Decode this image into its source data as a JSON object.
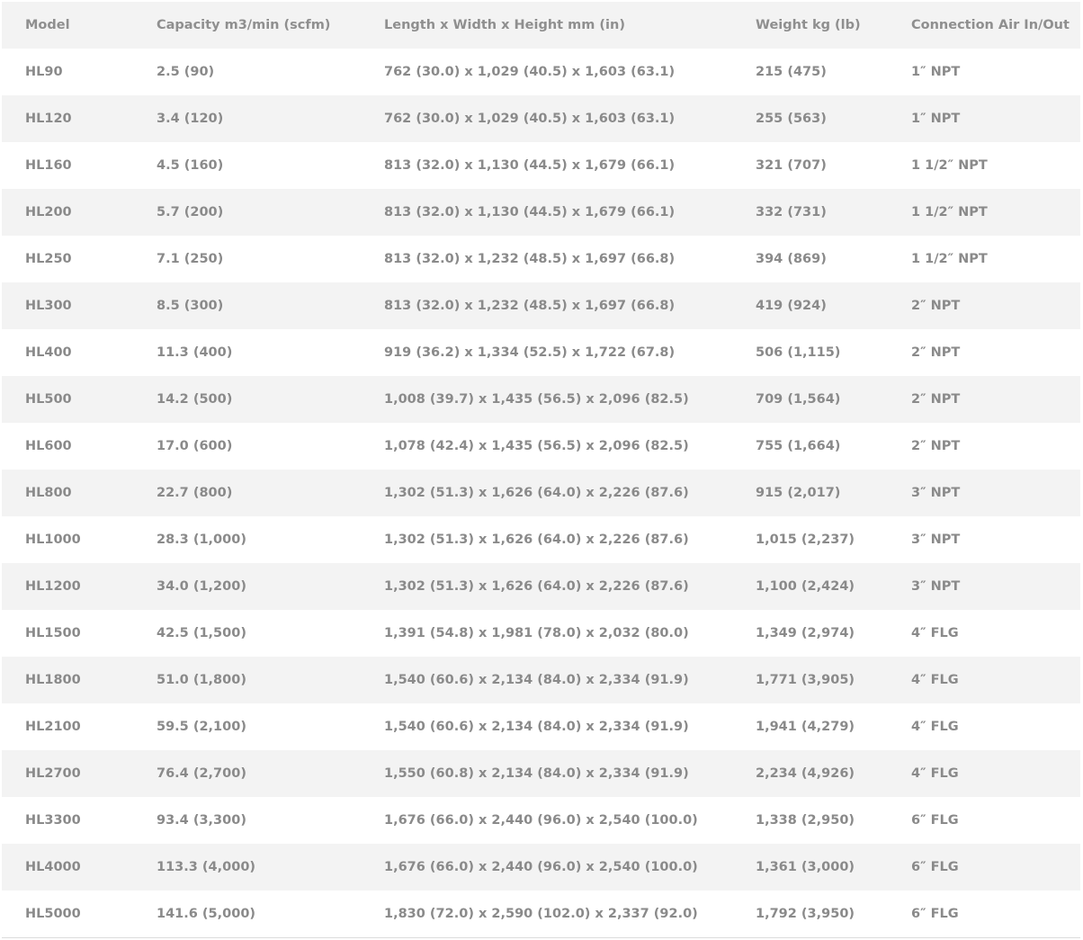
{
  "table": {
    "headers": [
      "Model",
      "Capacity m3/min (scfm)",
      "Length x Width x Height mm (in)",
      "Weight kg (lb)",
      "Connection Air In/Out"
    ],
    "rows": [
      [
        "HL90",
        "2.5 (90)",
        "762 (30.0) x 1,029 (40.5) x 1,603 (63.1)",
        "215 (475)",
        "1″ NPT"
      ],
      [
        "HL120",
        "3.4 (120)",
        "762 (30.0) x 1,029 (40.5) x 1,603 (63.1)",
        "255 (563)",
        "1″ NPT"
      ],
      [
        "HL160",
        "4.5 (160)",
        "813 (32.0) x 1,130 (44.5) x 1,679 (66.1)",
        "321 (707)",
        "1 1/2″ NPT"
      ],
      [
        "HL200",
        "5.7 (200)",
        "813 (32.0) x 1,130 (44.5) x 1,679 (66.1)",
        "332 (731)",
        "1 1/2″ NPT"
      ],
      [
        "HL250",
        "7.1 (250)",
        "813 (32.0) x 1,232 (48.5) x 1,697 (66.8)",
        "394 (869)",
        "1 1/2″ NPT"
      ],
      [
        "HL300",
        "8.5 (300)",
        "813 (32.0) x 1,232 (48.5) x 1,697 (66.8)",
        "419 (924)",
        "2″ NPT"
      ],
      [
        "HL400",
        "11.3 (400)",
        "919 (36.2) x 1,334 (52.5) x 1,722 (67.8)",
        "506 (1,115)",
        "2″ NPT"
      ],
      [
        "HL500",
        "14.2 (500)",
        "1,008 (39.7) x 1,435 (56.5) x 2,096 (82.5)",
        "709 (1,564)",
        "2″ NPT"
      ],
      [
        "HL600",
        "17.0 (600)",
        "1,078 (42.4) x 1,435 (56.5) x 2,096 (82.5)",
        "755 (1,664)",
        "2″ NPT"
      ],
      [
        "HL800",
        "22.7 (800)",
        "1,302 (51.3) x 1,626 (64.0) x 2,226 (87.6)",
        "915 (2,017)",
        "3″ NPT"
      ],
      [
        "HL1000",
        "28.3 (1,000)",
        "1,302 (51.3) x 1,626 (64.0) x 2,226 (87.6)",
        "1,015 (2,237)",
        "3″ NPT"
      ],
      [
        "HL1200",
        "34.0 (1,200)",
        "1,302 (51.3) x 1,626 (64.0) x 2,226 (87.6)",
        "1,100 (2,424)",
        "3″ NPT"
      ],
      [
        "HL1500",
        "42.5 (1,500)",
        "1,391 (54.8) x 1,981 (78.0) x 2,032 (80.0)",
        "1,349 (2,974)",
        "4″ FLG"
      ],
      [
        "HL1800",
        "51.0 (1,800)",
        "1,540 (60.6) x 2,134 (84.0) x 2,334 (91.9)",
        "1,771 (3,905)",
        "4″ FLG"
      ],
      [
        "HL2100",
        "59.5 (2,100)",
        "1,540 (60.6) x 2,134 (84.0) x 2,334 (91.9)",
        "1,941 (4,279)",
        "4″ FLG"
      ],
      [
        "HL2700",
        "76.4 (2,700)",
        "1,550 (60.8) x 2,134 (84.0) x 2,334 (91.9)",
        "2,234 (4,926)",
        "4″ FLG"
      ],
      [
        "HL3300",
        "93.4 (3,300)",
        "1,676 (66.0) x 2,440 (96.0) x 2,540 (100.0)",
        "1,338 (2,950)",
        "6″ FLG"
      ],
      [
        "HL4000",
        "113.3 (4,000)",
        "1,676 (66.0) x 2,440 (96.0) x 2,540 (100.0)",
        "1,361 (3,000)",
        "6″ FLG"
      ],
      [
        "HL5000",
        "141.6 (5,000)",
        "1,830 (72.0) x 2,590 (102.0) x 2,337 (92.0)",
        "1,792 (3,950)",
        "6″ FLG"
      ]
    ]
  },
  "colors": {
    "text": "#8a8a8a",
    "row_alt": "#f3f3f3",
    "row_base": "#ffffff"
  }
}
